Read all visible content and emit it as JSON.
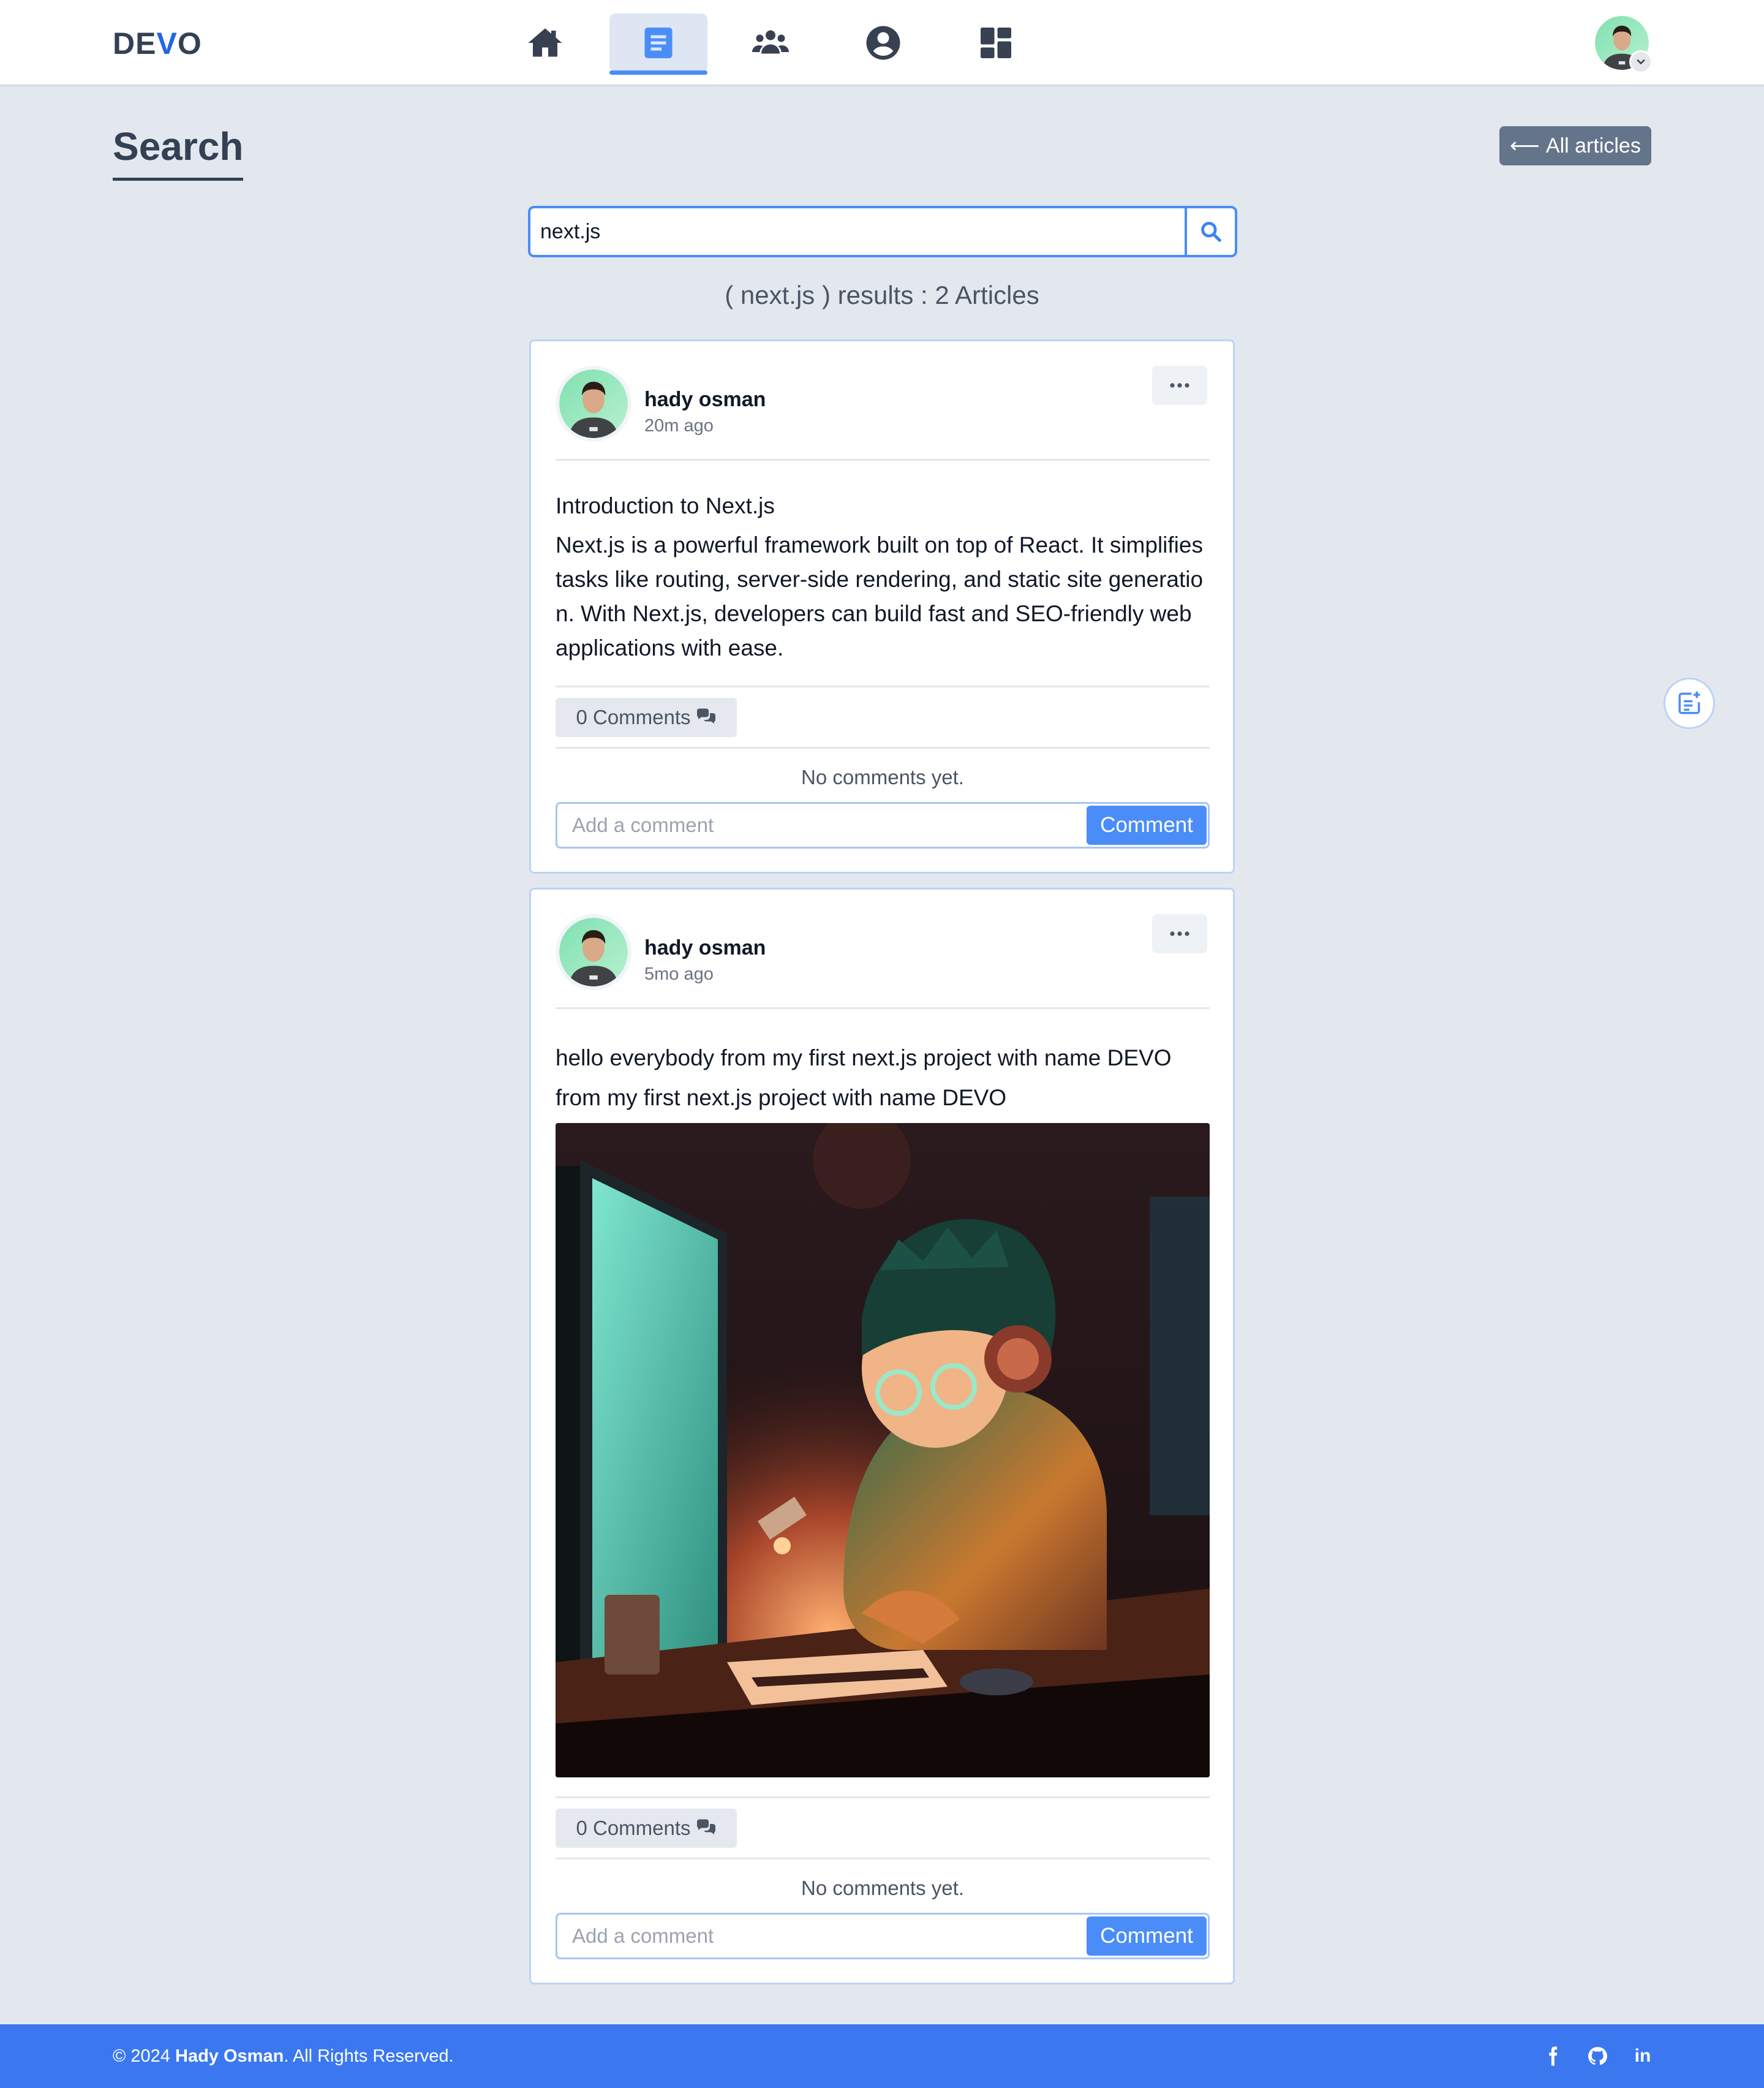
{
  "brand": {
    "prefix": "DE",
    "accent": "V",
    "suffix": "O",
    "accent_color": "#2563eb"
  },
  "nav": {
    "items": [
      {
        "icon": "home-icon",
        "active": false
      },
      {
        "icon": "articles-icon",
        "active": true
      },
      {
        "icon": "users-icon",
        "active": false
      },
      {
        "icon": "profile-icon",
        "active": false
      },
      {
        "icon": "dashboard-icon",
        "active": false
      }
    ]
  },
  "header": {
    "title": "Search",
    "all_articles_label": "All articles",
    "back_arrow": "⟵"
  },
  "search": {
    "value": "next.js",
    "placeholder": ""
  },
  "results": {
    "text": "( next.js ) results : 2 Articles"
  },
  "articles": [
    {
      "author": "hady osman",
      "time": "20m ago",
      "title": "Introduction to Next.js",
      "body": "Next.js is a powerful framework built on top of React. It simplifies tasks like routing, server-side rendering, and static site generation. With Next.js, developers can build fast and SEO-friendly web applications with ease.",
      "comments_label": "0 Comments",
      "no_comments": "No comments yet.",
      "comment_placeholder": "Add a comment",
      "comment_button": "Comment"
    },
    {
      "author": "hady osman",
      "time": "5mo ago",
      "title": "hello everybody from my first next.js project with name DEVO",
      "body": "from my first next.js project with name DEVO",
      "comments_label": "0 Comments",
      "no_comments": "No comments yet.",
      "comment_placeholder": "Add a comment",
      "comment_button": "Comment"
    }
  ],
  "footer": {
    "copy": "© 2024",
    "owner": "Hady Osman",
    "rights": ". All Rights Reserved.",
    "social": [
      "facebook-icon",
      "github-icon",
      "linkedin-icon"
    ],
    "linkedin_text": "in"
  },
  "colors": {
    "primary": "#4b8df8",
    "footer": "#3b78f0",
    "background": "#e3e8ef",
    "slate_button": "#64748b"
  }
}
